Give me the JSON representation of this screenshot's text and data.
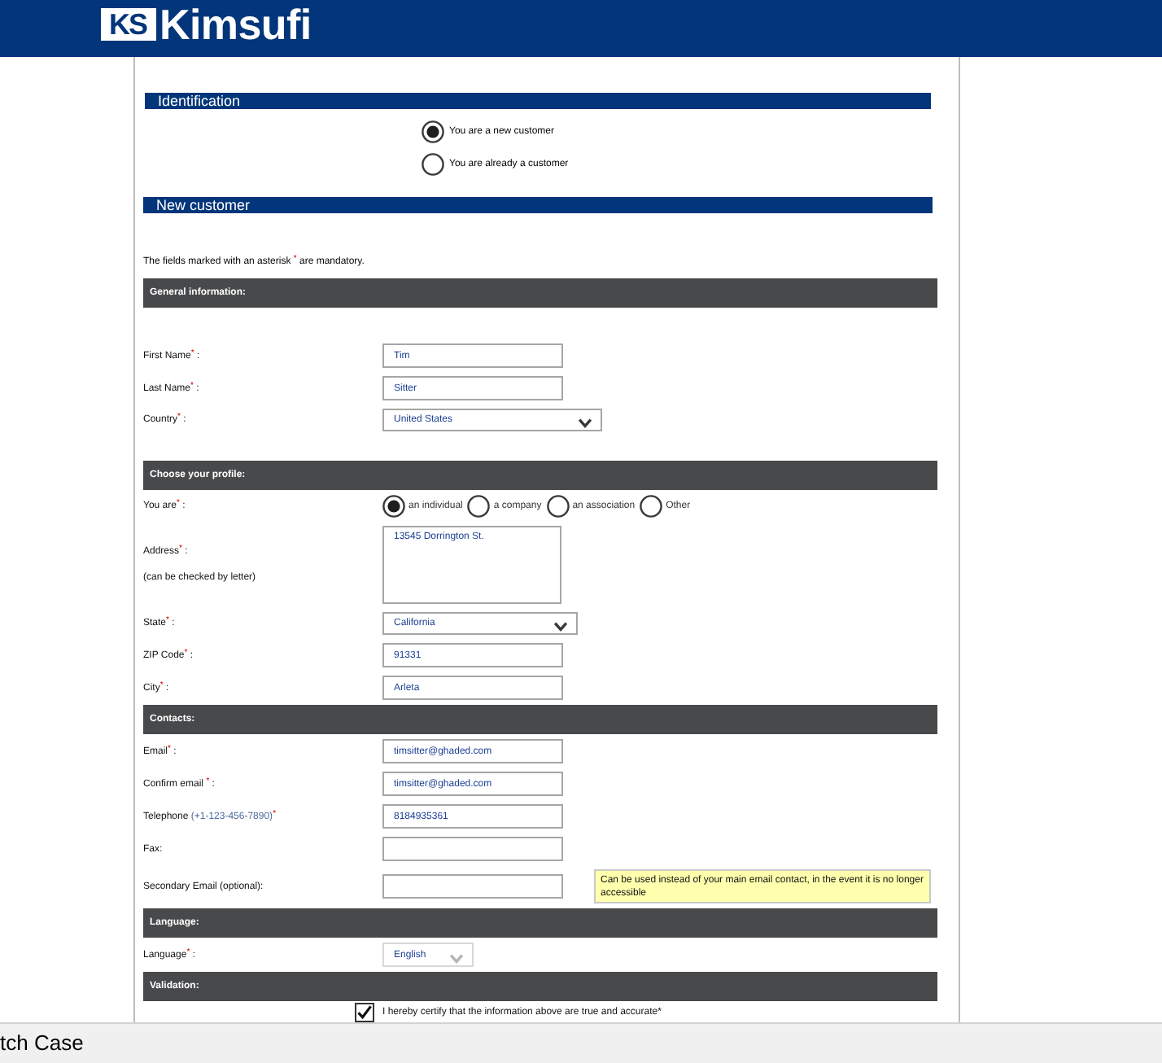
{
  "header": {
    "logo_mark": "KS",
    "logo_text": "Kimsufi"
  },
  "identification": {
    "title": "Identification",
    "options": [
      {
        "label": "You are a new customer",
        "selected": true
      },
      {
        "label": "You are already a customer",
        "selected": false
      }
    ]
  },
  "new_customer": {
    "title": "New customer",
    "note": "The fields marked with an asterisk $^{*}$ are mandatory."
  },
  "sections": [
    {
      "title": "General information:",
      "rows": [
        {
          "kind": "text",
          "label": "First Name$^{*}$ :",
          "value": "Tim"
        },
        {
          "kind": "text",
          "label": "Last Name$^{*}$ :",
          "value": "Sitter"
        },
        {
          "kind": "select",
          "label": "Country$^{*}$ :",
          "value": "United States"
        }
      ]
    },
    {
      "title": "Choose your profile:",
      "rows": [
        {
          "kind": "radios",
          "label": "You are$^{*}$ :",
          "options": [
            {
              "label": "an individual",
              "selected": true
            },
            {
              "label": "a company",
              "selected": false
            },
            {
              "label": "an association",
              "selected": false
            },
            {
              "label": "Other",
              "selected": false
            }
          ]
        },
        {
          "kind": "textarea",
          "label": "Address$^{*}$ :",
          "sublabel": "(can be checked by letter)",
          "value": "13545 Dorrington St."
        },
        {
          "kind": "select",
          "label": "State$^{*}$ :",
          "value": "California"
        },
        {
          "kind": "text",
          "label": "ZIP Code$^{*}$ :",
          "value": "91331"
        },
        {
          "kind": "text",
          "label": "City$^{*}$ :",
          "value": "Arleta"
        }
      ]
    },
    {
      "title": "Contacts:",
      "rows": [
        {
          "kind": "text",
          "label": "Email$^{*}$ :",
          "value": "timsitter@ghaded.com"
        },
        {
          "kind": "text",
          "label": "Confirm email $^{*}$ :",
          "value": "timsitter@ghaded.com"
        },
        {
          "kind": "text",
          "label": "Telephone",
          "hint": "(+1-123-456-7890)",
          "label_end": "$^{*}$",
          "value": "8184935361"
        },
        {
          "kind": "text",
          "label": "Fax:"
        },
        {
          "kind": "text",
          "label": "Secondary Email (optional):",
          "note": "Can be used instead of your main email contact, in the event it is no longer accessible"
        }
      ]
    },
    {
      "title": "Language:",
      "rows": [
        {
          "kind": "small-select",
          "label": "Language$^{*}$ :",
          "value": "English"
        }
      ]
    },
    {
      "title": "Validation:",
      "rows": [
        {
          "kind": "checkbox",
          "label": "I hereby certify that the information above are true and accurate*",
          "checked": true
        }
      ]
    }
  ],
  "find_bar": {
    "label": "tch Case"
  }
}
